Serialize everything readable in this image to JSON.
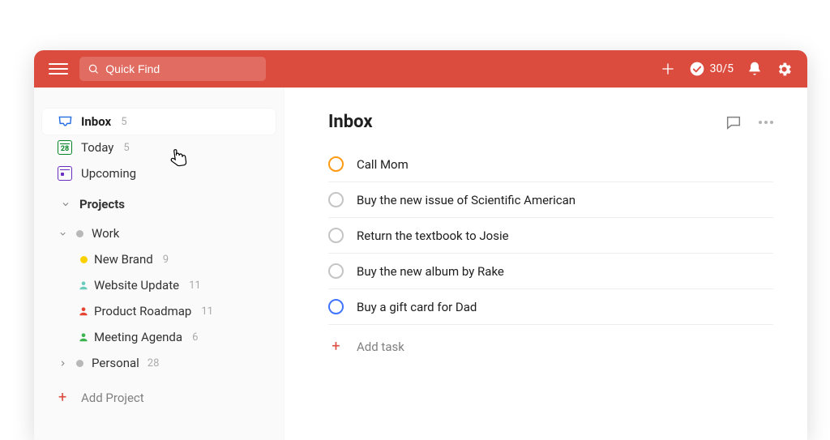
{
  "colors": {
    "accent": "#db4c3f"
  },
  "topbar": {
    "search_placeholder": "Quick Find",
    "productivity": "30/5"
  },
  "sidebar": {
    "inbox": {
      "label": "Inbox",
      "count": "5"
    },
    "today": {
      "label": "Today",
      "count": "5",
      "day": "28"
    },
    "upcoming": {
      "label": "Upcoming"
    },
    "projects_label": "Projects",
    "groups": [
      {
        "name": "Work",
        "expanded": true,
        "projects": [
          {
            "name": "New Brand",
            "count": "9",
            "color": "#fad000",
            "icon": "dot"
          },
          {
            "name": "Website Update",
            "count": "11",
            "color": "#6accbc",
            "icon": "person"
          },
          {
            "name": "Product Roadmap",
            "count": "11",
            "color": "#e44332",
            "icon": "person"
          },
          {
            "name": "Meeting Agenda",
            "count": "6",
            "color": "#3cb34f",
            "icon": "person"
          }
        ]
      },
      {
        "name": "Personal",
        "count": "28",
        "expanded": false
      }
    ],
    "add_project": "Add Project"
  },
  "content": {
    "title": "Inbox",
    "add_task": "Add task",
    "tasks": [
      {
        "title": "Call Mom",
        "priority": "orange"
      },
      {
        "title": "Buy the new issue of Scientific American",
        "priority": "none"
      },
      {
        "title": "Return the textbook to Josie",
        "priority": "none"
      },
      {
        "title": "Buy the new album by Rake",
        "priority": "none"
      },
      {
        "title": "Buy a gift card for Dad",
        "priority": "blue"
      }
    ]
  }
}
